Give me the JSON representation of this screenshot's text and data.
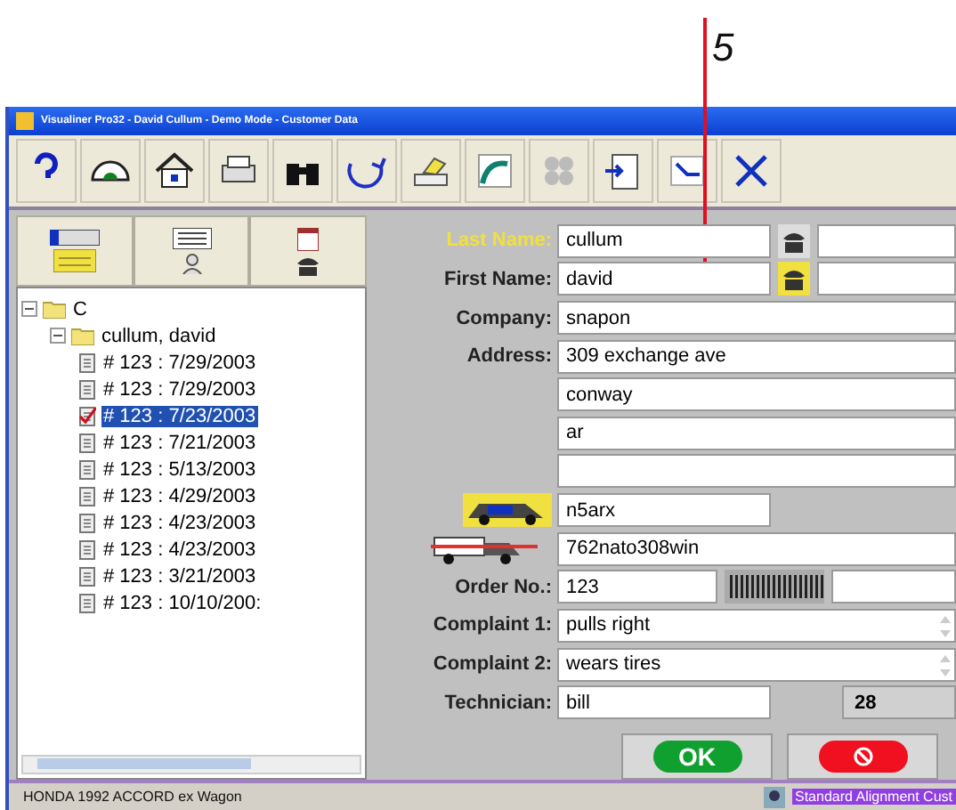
{
  "callout": {
    "label": "5"
  },
  "window": {
    "title": "Visualiner Pro32 - David Cullum - Demo Mode - Customer Data"
  },
  "tree": {
    "label": "C",
    "expanded": true,
    "children": [
      {
        "label": "cullum, david",
        "expanded": true,
        "children": [
          {
            "label": "# 123 : 7/29/2003",
            "selected": false
          },
          {
            "label": "# 123 : 7/29/2003",
            "selected": false
          },
          {
            "label": "# 123 : 7/23/2003",
            "selected": true
          },
          {
            "label": "# 123 : 7/21/2003",
            "selected": false
          },
          {
            "label": "# 123 : 5/13/2003",
            "selected": false
          },
          {
            "label": "# 123 : 4/29/2003",
            "selected": false
          },
          {
            "label": "# 123 : 4/23/2003",
            "selected": false
          },
          {
            "label": "# 123 : 4/23/2003",
            "selected": false
          },
          {
            "label": "# 123 : 3/21/2003",
            "selected": false
          },
          {
            "label": "# 123 : 10/10/200:",
            "selected": false
          }
        ]
      }
    ]
  },
  "form": {
    "fields": [
      {
        "kind": "phone",
        "label": "Last Name:",
        "highlighted": true,
        "value": "cullum"
      },
      {
        "kind": "phone",
        "label": "First Name:",
        "highlighted": false,
        "value": "david"
      },
      {
        "kind": "full",
        "label": "Company:",
        "highlighted": false,
        "value": "snapon"
      },
      {
        "kind": "full",
        "label": "Address:",
        "highlighted": false,
        "value": "309 exchange ave"
      },
      {
        "kind": "full",
        "value": "conway"
      },
      {
        "kind": "full",
        "value": "ar"
      },
      {
        "kind": "full"
      },
      {
        "kind": "plate",
        "value": "n5arx"
      },
      {
        "kind": "vin",
        "value": "762nato308win"
      },
      {
        "kind": "barcode",
        "label": "Order No.:",
        "highlighted": false,
        "value": "123"
      },
      {
        "kind": "memo",
        "label": "Complaint 1:",
        "highlighted": false,
        "value": "pulls right"
      },
      {
        "kind": "memo",
        "label": "Complaint 2:",
        "highlighted": false,
        "value": "wears tires"
      },
      {
        "kind": "counter",
        "label": "Technician:",
        "highlighted": false,
        "value": "bill",
        "counter": "28"
      }
    ],
    "ok_label": "OK"
  },
  "status_bar": {
    "vehicle": "HONDA 1992 ACCORD ex Wagon",
    "mode": "Standard Alignment Cust"
  }
}
